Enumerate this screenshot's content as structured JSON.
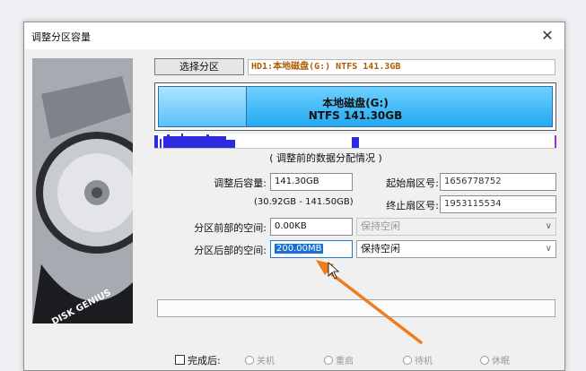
{
  "window": {
    "title": "调整分区容量",
    "close_glyph": "✕"
  },
  "toolbar": {
    "select_partition_label": "选择分区"
  },
  "disk_info": "HD1:本地磁盘(G:) NTFS 141.3GB",
  "partition": {
    "name": "本地磁盘(G:)",
    "detail": "NTFS 141.30GB"
  },
  "map_caption": "( 调整前的数据分配情况 )",
  "fields": {
    "size_after_label": "调整后容量:",
    "size_after_value": "141.30GB",
    "range_text": "(30.92GB - 141.50GB)",
    "start_sector_label": "起始扇区号:",
    "start_sector_value": "1656778752",
    "end_sector_label": "终止扇区号:",
    "end_sector_value": "1953115534",
    "space_before_label": "分区前部的空间:",
    "space_before_value": "0.00KB",
    "space_before_option": "保持空闲",
    "space_after_label": "分区后部的空间:",
    "space_after_value": "200.00MB",
    "space_after_option": "保持空闲"
  },
  "completion": {
    "label": "完成后:",
    "options": [
      "关机",
      "重启",
      "待机",
      "休眠"
    ]
  },
  "art": {
    "brand_text": "DISK GENIUS"
  },
  "colors": {
    "accent": "#1a6fd1",
    "arrow": "#f07c1e",
    "partition_fill": "#23a9f0"
  }
}
